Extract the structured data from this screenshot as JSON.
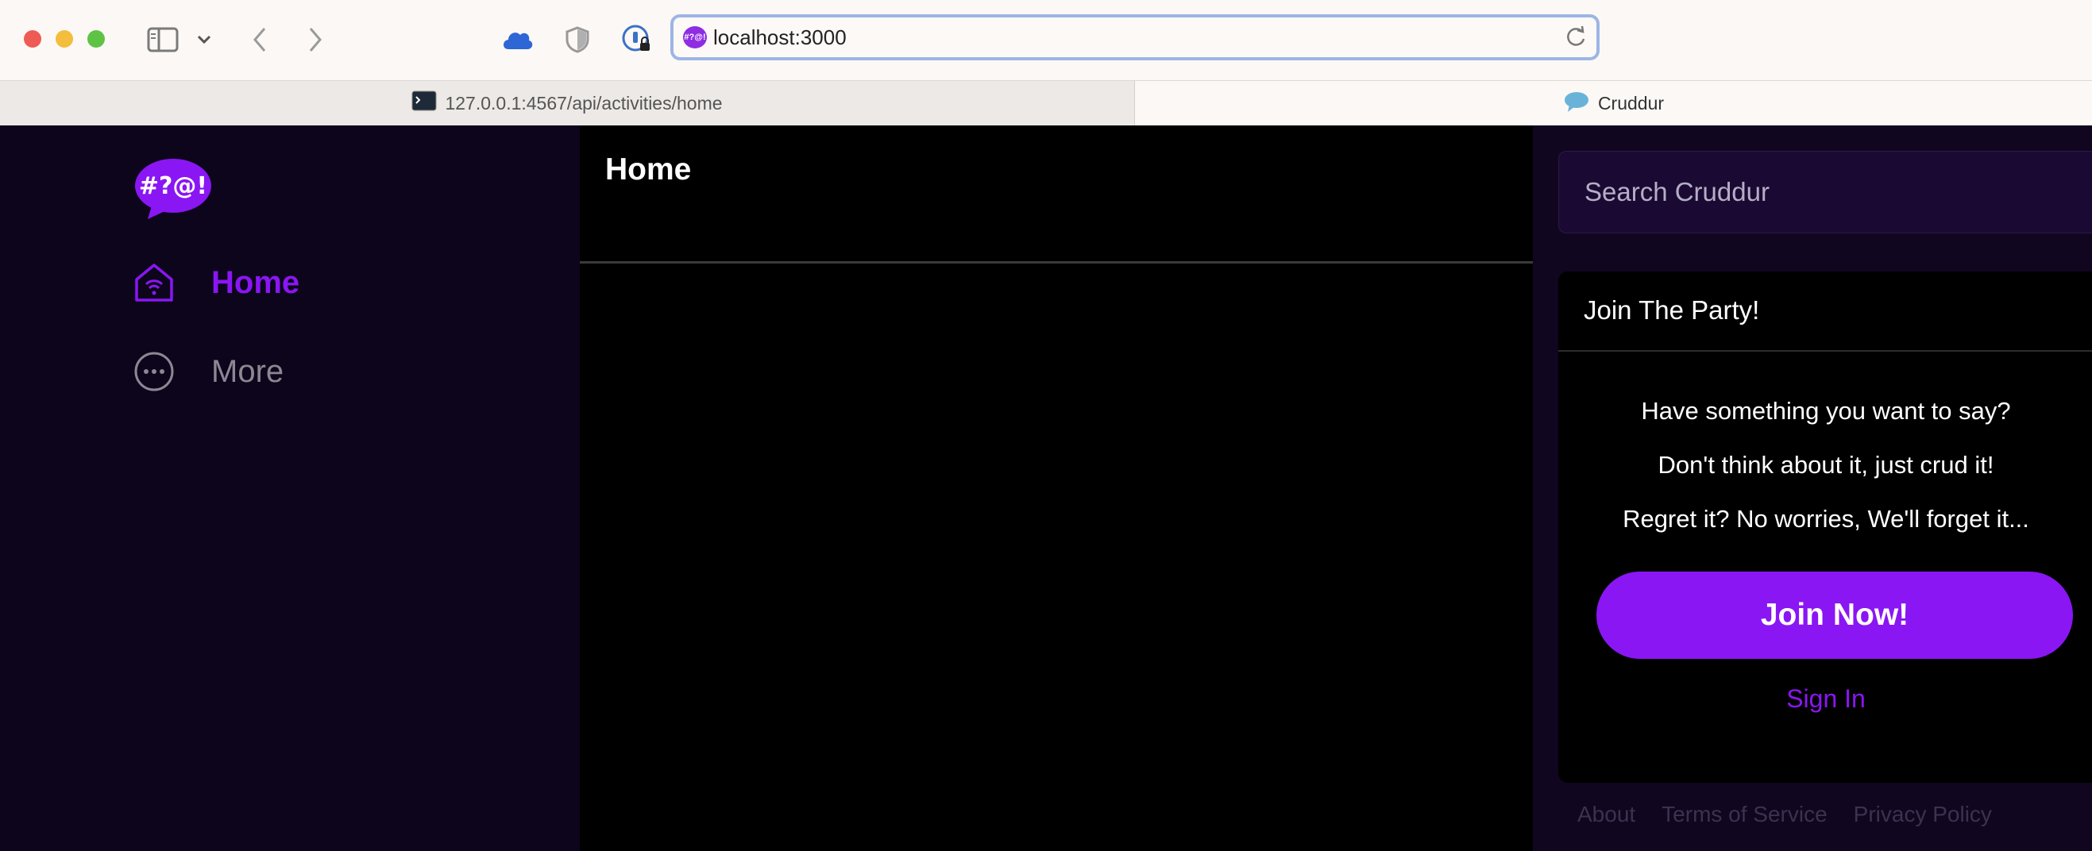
{
  "browser": {
    "url": "localhost:3000",
    "tabs": [
      {
        "label": "127.0.0.1:4567/api/activities/home"
      },
      {
        "label": "Cruddur"
      }
    ],
    "favicon_text": "#?@!"
  },
  "app": {
    "logo_text": "#?@!",
    "nav": [
      {
        "label": "Home",
        "icon": "home-icon",
        "active": true
      },
      {
        "label": "More",
        "icon": "more-icon",
        "active": false
      }
    ],
    "page_title": "Home",
    "search": {
      "placeholder": "Search Cruddur"
    },
    "join_card": {
      "title": "Join The Party!",
      "lines": [
        "Have something you want to say?",
        "Don't think about it, just crud it!",
        "Regret it? No worries, We'll forget it..."
      ],
      "button": "Join Now!",
      "sign_in": "Sign In"
    },
    "footer": [
      "About",
      "Terms of Service",
      "Privacy Policy"
    ],
    "colors": {
      "accent": "#8a16f3",
      "nav_bg": "#0c051b",
      "muted": "#8d8794"
    }
  }
}
